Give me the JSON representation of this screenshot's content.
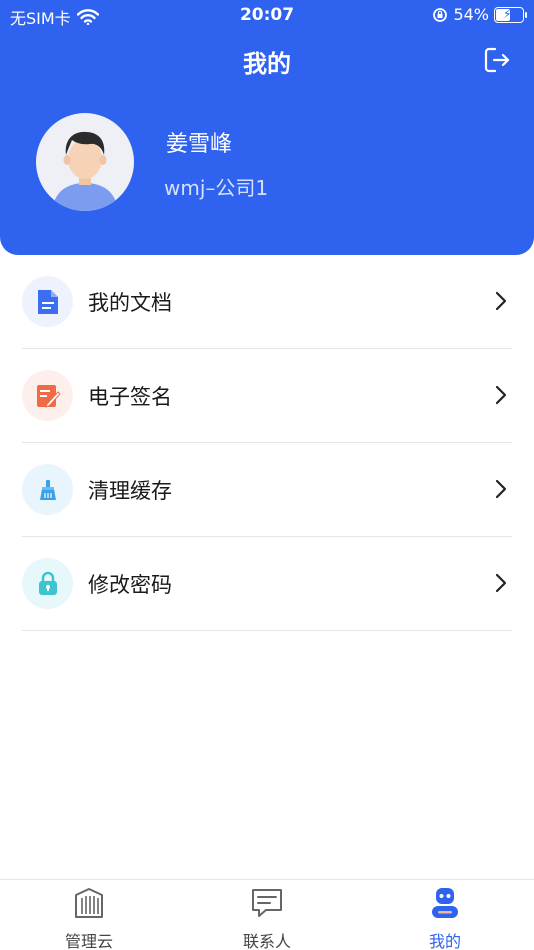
{
  "status": {
    "carrier": "无SIM卡",
    "time": "20:07",
    "battery": "54%",
    "battery_level": 0.54
  },
  "header": {
    "title": "我的",
    "logout_icon": "logout-icon"
  },
  "profile": {
    "name": "姜雪峰",
    "company": "wmj–公司1"
  },
  "menu": {
    "items": [
      {
        "label": "我的文档",
        "icon": "document-icon",
        "color": "#3b6ef0",
        "bg": "#eef2fd"
      },
      {
        "label": "电子签名",
        "icon": "signature-icon",
        "color": "#ef6a45",
        "bg": "#fdf0ec"
      },
      {
        "label": "清理缓存",
        "icon": "broom-icon",
        "color": "#3aa0ea",
        "bg": "#e9f5fd"
      },
      {
        "label": "修改密码",
        "icon": "lock-icon",
        "color": "#3cc5cf",
        "bg": "#e6f8f9"
      }
    ]
  },
  "tabbar": {
    "tabs": [
      {
        "label": "管理云",
        "icon": "building-icon"
      },
      {
        "label": "联系人",
        "icon": "message-icon"
      },
      {
        "label": "我的",
        "icon": "robot-icon"
      }
    ],
    "active_color": "#2f63ef"
  },
  "colors": {
    "brand": "#2f63ef"
  }
}
